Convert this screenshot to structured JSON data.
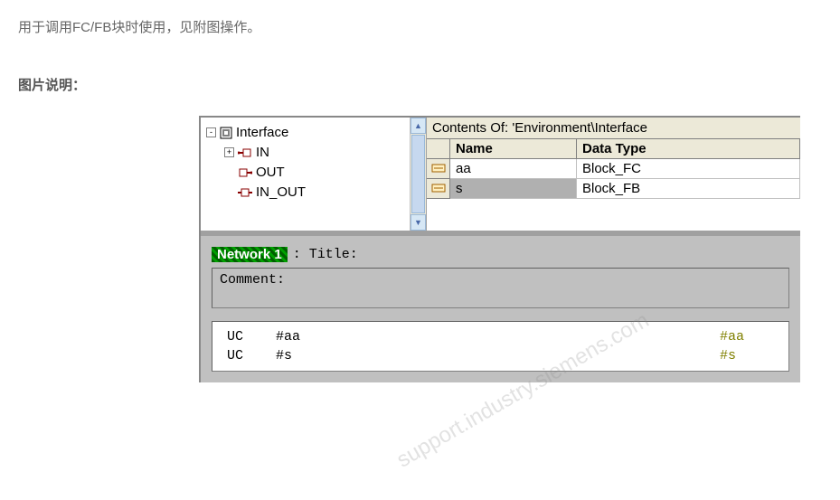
{
  "intro": "用于调用FC/FB块时使用，见附图操作。",
  "section_title": "图片说明：",
  "tree": {
    "root": "Interface",
    "children": [
      "IN",
      "OUT",
      "IN_OUT"
    ],
    "root_expander": "-",
    "child_expander": "+"
  },
  "contents_header": "Contents Of: 'Environment\\Interface",
  "grid": {
    "headers": {
      "name": "Name",
      "type": "Data Type"
    },
    "rows": [
      {
        "name": "aa",
        "type": "Block_FC"
      },
      {
        "name": "s",
        "type": "Block_FB"
      }
    ]
  },
  "network": {
    "label": "Network 1",
    "title_suffix": ": Title:",
    "comment_label": "Comment:",
    "code": [
      {
        "op": "UC",
        "arg": "#aa",
        "rem": "#aa"
      },
      {
        "op": "UC",
        "arg": "#s",
        "rem": "#s"
      }
    ]
  },
  "watermark": "support.industry.siemens.com",
  "scroll": {
    "up": "▲",
    "down": "▼"
  }
}
